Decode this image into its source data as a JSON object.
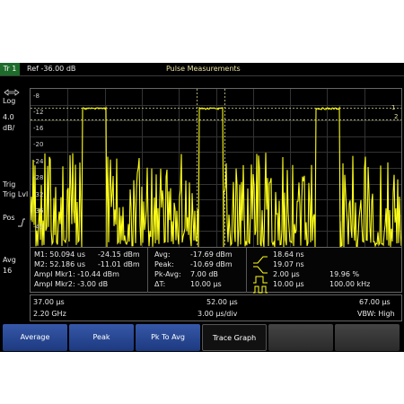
{
  "header": {
    "trace_tab": "Tr 1",
    "reference": "Ref -36.00 dB",
    "measurement_title": "Pulse Measurements"
  },
  "left_panel": {
    "scale_type": "Log",
    "scale_value": "4.0",
    "scale_unit": "dB/",
    "trig_label": "Trig",
    "trig_lvl_label": "Trig Lvl",
    "pos_label": "Pos",
    "avg_label": "Avg",
    "avg_count": "16"
  },
  "y_axis": {
    "ticks": [
      "-8",
      "-12",
      "-16",
      "-20",
      "-24",
      "-28",
      "-32",
      "-36",
      "-40"
    ]
  },
  "right_markers": {
    "marker1": "1",
    "marker2": "2"
  },
  "markers": {
    "m1_label": "M1: 50.094 us",
    "m1_value": "-24.15 dBm",
    "m2_label": "M2: 52.186 us",
    "m2_value": "-11.01 dBm",
    "ampl_mkr1": "Ampl Mkr1: -10.44 dBm",
    "ampl_mkr2": "Ampl Mkr2: -3.00 dB"
  },
  "stats": {
    "avg_label": "Avg:",
    "avg_value": "-17.69 dBm",
    "peak_label": "Peak:",
    "peak_value": "-10.69 dBm",
    "pkavg_label": "Pk-Avg:",
    "pkavg_value": "7.00 dB",
    "delta_t_label": "ΔT:",
    "delta_t_value": "10.00 µs"
  },
  "pulse": {
    "rise_time": "18.64 ns",
    "fall_time": "19.07 ns",
    "pulse_width": "2.00 µs",
    "period": "10.00 µs",
    "duty_cycle": "19.96  %",
    "prf": "100.00 kHz"
  },
  "axis_info": {
    "x_start": "37.00 µs",
    "x_center": "52.00 µs",
    "x_stop": "67.00 µs",
    "frequency": "2.20 GHz",
    "time_per_div": "3.00 µs/div",
    "vbw": "VBW: High"
  },
  "softkeys": [
    "Average",
    "Peak",
    "Pk To Avg",
    "Trace Graph",
    "",
    ""
  ],
  "colors": {
    "trace": "#ffff1a",
    "marker_line": "#d8d890",
    "tab_green": "#1d6c2a",
    "softkey_blue": "#2b4a98"
  }
}
